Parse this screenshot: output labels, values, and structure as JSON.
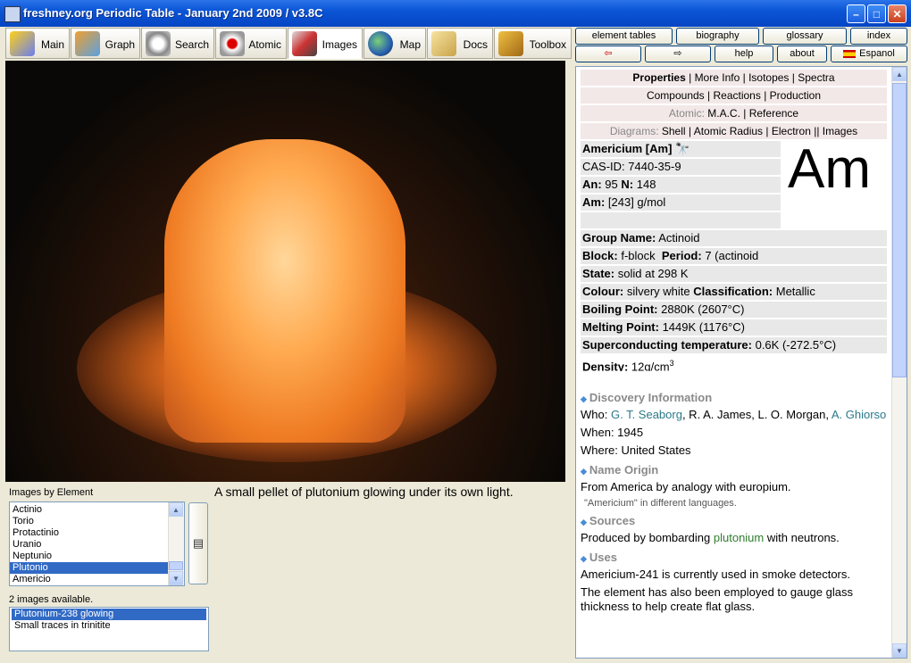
{
  "window": {
    "title": "freshney.org Periodic Table - January 2nd 2009 / v3.8C"
  },
  "toolbar": {
    "tabs": [
      "Main",
      "Graph",
      "Search",
      "Atomic",
      "Images",
      "Map",
      "Docs",
      "Toolbox"
    ],
    "active": "Images"
  },
  "right_buttons": {
    "row1": [
      "element tables",
      "biography",
      "glossary",
      "index"
    ],
    "row2": [
      "⇦",
      "⇨",
      "help",
      "about",
      "Espanol"
    ]
  },
  "image_panel": {
    "caption": "A small pellet of plutonium glowing under its own light.",
    "label_by_element": "Images by Element",
    "elements": [
      "Actinio",
      "Torio",
      "Protactinio",
      "Uranio",
      "Neptunio",
      "Plutonio",
      "Americio"
    ],
    "selected_element": "Plutonio",
    "available_label": "2 images available.",
    "images": [
      "Plutonium-238 glowing",
      "Small traces in trinitite"
    ],
    "selected_image": "Plutonium-238 glowing"
  },
  "info": {
    "nav1": [
      "Properties",
      "More Info",
      "Isotopes",
      "Spectra"
    ],
    "nav2": [
      "Compounds",
      "Reactions",
      "Production"
    ],
    "nav3_label": "Atomic:",
    "nav3": [
      "M.A.C.",
      "Reference"
    ],
    "nav4_label": "Diagrams:",
    "nav4": [
      "Shell",
      "Atomic Radius",
      "Electron",
      "Images"
    ],
    "element_name": "Americium [Am]",
    "symbol": "Am",
    "cas": "CAS-ID: 7440-35-9",
    "an_label": "An:",
    "an": "95",
    "n_label": "N:",
    "n": "148",
    "am_label": "Am:",
    "am": "[243] g/mol",
    "group_label": "Group Name:",
    "group": "Actinoid",
    "block_label": "Block:",
    "block": "f-block",
    "period_label": "Period:",
    "period": "7 (actinoid",
    "state_label": "State:",
    "state": "solid at 298 K",
    "colour_label": "Colour:",
    "colour": "silvery white",
    "class_label": "Classification:",
    "class": "Metallic",
    "bp_label": "Boiling Point:",
    "bp": "2880K (2607°C)",
    "mp_label": "Melting Point:",
    "mp": "1449K (1176°C)",
    "sc_label": "Superconducting temperature:",
    "sc": "0.6K (-272.5°C)",
    "density_label": "Density:",
    "density": "12g/cm",
    "density_sup": "3",
    "discovery_head": "Discovery Information",
    "who_label": "Who:",
    "who_1": "G. T. Seaborg",
    "who_2": ", R. A. James, L. O. Morgan, ",
    "who_3": "A. Ghiorso",
    "when": "When: 1945",
    "where": "Where: United States",
    "origin_head": "Name Origin",
    "origin": "From America by analogy with europium.",
    "origin_small": "\"Americium\" in different languages.",
    "sources_head": "Sources",
    "sources_1": "Produced by bombarding ",
    "sources_link": "plutonium",
    "sources_2": " with neutrons.",
    "uses_head": "Uses",
    "uses_1": "Americium-241 is currently used in smoke detectors.",
    "uses_2": "The element has also been employed to gauge glass thickness to help create flat glass."
  }
}
